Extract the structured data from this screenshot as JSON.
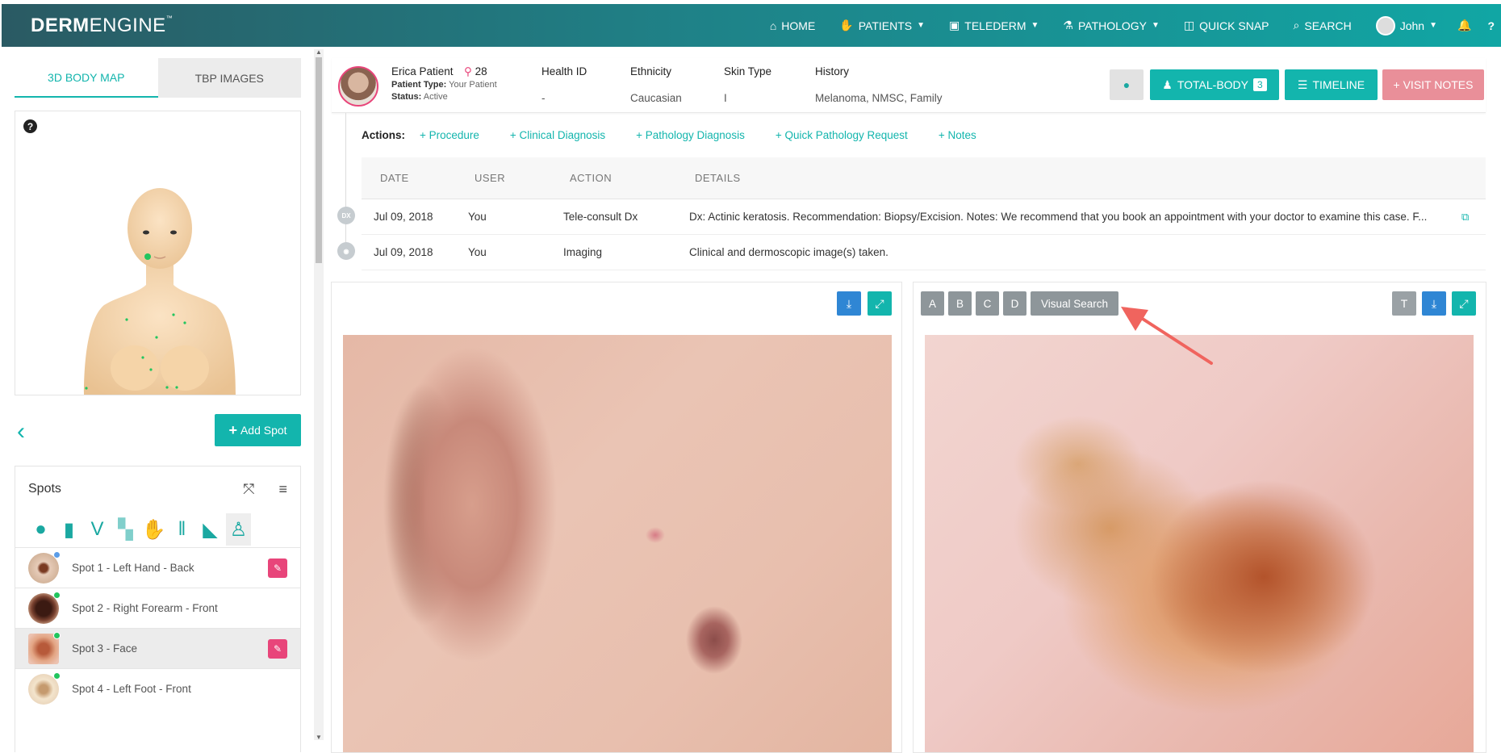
{
  "nav": {
    "logo_bold": "DERM",
    "logo_light": "ENGINE",
    "logo_tm": "™",
    "items": [
      {
        "label": "HOME",
        "icon": "home-icon"
      },
      {
        "label": "PATIENTS",
        "icon": "patients-icon"
      },
      {
        "label": "TELEDERM",
        "icon": "telederm-icon"
      },
      {
        "label": "PATHOLOGY",
        "icon": "microscope-icon"
      },
      {
        "label": "QUICK SNAP",
        "icon": "camera-icon"
      },
      {
        "label": "SEARCH",
        "icon": "search-icon"
      }
    ],
    "user": "John"
  },
  "left": {
    "tabs": [
      "3D BODY MAP",
      "TBP IMAGES"
    ],
    "add_spot": "Add Spot",
    "spots_title": "Spots",
    "spots": [
      {
        "label": "Spot 1 - Left Hand - Back",
        "dot": "#5b9de8",
        "edit": true
      },
      {
        "label": "Spot 2 - Right Forearm - Front",
        "dot": "#22c55e",
        "edit": false
      },
      {
        "label": "Spot 3 - Face",
        "dot": "#22c55e",
        "edit": true
      },
      {
        "label": "Spot 4 - Left Foot - Front",
        "dot": "#22c55e",
        "edit": false
      }
    ]
  },
  "patient": {
    "name": "Erica Patient",
    "age": "28",
    "type_label": "Patient Type:",
    "type_value": "Your Patient",
    "status_label": "Status:",
    "status_value": "Active",
    "cols": [
      {
        "h": "Health ID",
        "v": "-"
      },
      {
        "h": "Ethnicity",
        "v": "Caucasian"
      },
      {
        "h": "Skin Type",
        "v": "I"
      },
      {
        "h": "History",
        "v": "Melanoma, NMSC, Family"
      }
    ],
    "btn_total": "TOTAL-BODY",
    "btn_total_count": "3",
    "btn_timeline": "TIMELINE",
    "btn_visit": "+ VISIT NOTES"
  },
  "actions": {
    "label": "Actions:",
    "links": [
      "+ Procedure",
      "+ Clinical Diagnosis",
      "+ Pathology Diagnosis",
      "+ Quick Pathology Request",
      "+ Notes"
    ]
  },
  "timeline": {
    "headers": [
      "DATE",
      "USER",
      "ACTION",
      "DETAILS"
    ],
    "rows": [
      {
        "badge": "DX",
        "date": "Jul 09, 2018",
        "user": "You",
        "action": "Tele-consult Dx",
        "details": "Dx: Actinic keratosis. Recommendation: Biopsy/Excision. Notes: We recommend that you book an appointment with your doctor to examine this case. F..."
      },
      {
        "badge": "",
        "date": "Jul 09, 2018",
        "user": "You",
        "action": "Imaging",
        "details": "Clinical and dermoscopic image(s) taken."
      }
    ]
  },
  "viewer": {
    "letters": [
      "A",
      "B",
      "C",
      "D"
    ],
    "visual_search": "Visual Search"
  },
  "colors": {
    "accent": "#13b5ad",
    "pink": "#e8457a",
    "blue": "#2f86d4"
  }
}
